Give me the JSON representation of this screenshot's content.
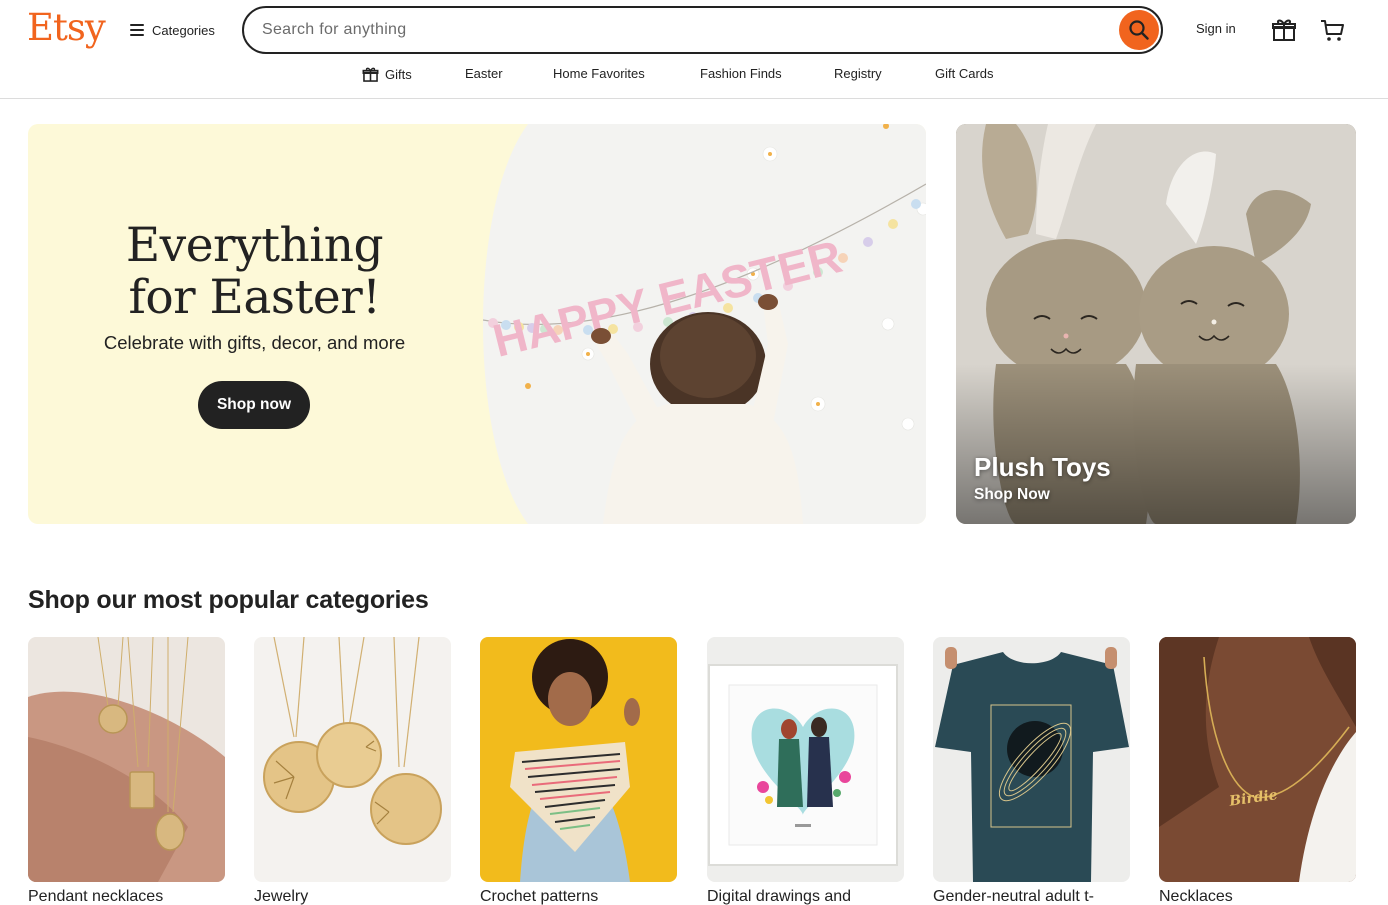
{
  "header": {
    "logo": "Etsy",
    "categories_label": "Categories",
    "search_placeholder": "Search for anything",
    "sign_in": "Sign in"
  },
  "subnav": [
    {
      "label": "Gifts"
    },
    {
      "label": "Easter"
    },
    {
      "label": "Home Favorites"
    },
    {
      "label": "Fashion Finds"
    },
    {
      "label": "Registry"
    },
    {
      "label": "Gift Cards"
    }
  ],
  "hero": {
    "title_line1": "Everything",
    "title_line2": "for Easter!",
    "subtitle": "Celebrate with gifts, decor, and more",
    "button": "Shop now",
    "banner_text": "HAPPY EASTER"
  },
  "promo": {
    "title": "Plush Toys",
    "link": "Shop Now"
  },
  "popular": {
    "title": "Shop our most popular categories",
    "items": [
      {
        "label": "Pendant necklaces"
      },
      {
        "label": "Jewelry"
      },
      {
        "label": "Crochet patterns"
      },
      {
        "label": "Digital drawings and"
      },
      {
        "label": "Gender-neutral adult t-"
      },
      {
        "label": "Necklaces"
      }
    ]
  },
  "colors": {
    "brand": "#f1641e",
    "text": "#222222",
    "hero_bg": "#fdf9d8"
  }
}
